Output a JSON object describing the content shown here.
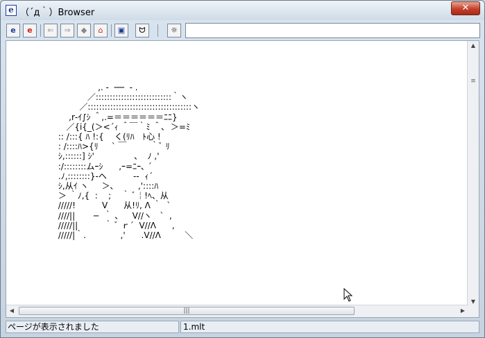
{
  "window": {
    "title": "（´д｀）Browser",
    "icon": "ie-e-icon",
    "close_label": "✕"
  },
  "toolbar": {
    "buttons": [
      {
        "icon": "browser-e-icon",
        "glyph": "e"
      },
      {
        "icon": "browser-e-red-icon",
        "glyph": "e"
      },
      {
        "icon": "back-icon",
        "glyph": "⇐"
      },
      {
        "icon": "forward-icon",
        "glyph": "⇒"
      },
      {
        "icon": "stop-icon",
        "glyph": "◆"
      },
      {
        "icon": "home-icon",
        "glyph": "⌂"
      },
      {
        "icon": "window-icon",
        "glyph": "▣"
      },
      {
        "icon": "face-icon",
        "glyph": "ᗢ"
      },
      {
        "icon": "settings-icon",
        "glyph": "☼"
      }
    ],
    "address_value": ""
  },
  "content": {
    "ascii_art": "                     ,. -  ──  - .\n                 ／:::::::::::::::::::::::::::｀ヽ\n              ／:::::::::::::::::::::::::::::::::::::ヽ\n          ,r‐ｲ∫ｼ ＾,.=＝＝＝＝＝＝ﾆﾆ}\n         ／{i{_(＞<´ｨ ＾￣｀ﾐ ＾､  ＞=ﾐ\n      :: /:::{ ﾊ !:{    く(ﾘﾊ   ﾄ心 !\n      : /::::ﾊ>{ﾘ     ` ￣         ｀ﾞ ﾘ\n      ｼ,::::::] ｼ'               、  ﾉ ,'\n      :/::::::::ムｰｼ      ,ｰ=ﾆｰ､ ´\n      .ﾉ,::::::::}‐ヘ          ‐‐  ｨ´\n      ｼ,从ｲ ヽ     ＞､         ,'::::ﾊ\n      ＞ ｀ﾉ,{  :    ;    ｀ ﾞ￤!ﾍ、从\n      /////!          V      从!ﾘ, Λ ｀  ` \n      ////||       ─  ｀ ､     V//ヽ   `  ,\n      /////||          ｀ ﾞ ｒ´  V//Λ      ,    \n      /////|｀.             ,'      .V//Λ         ＼"
  },
  "status": {
    "message": "ページが表示されました",
    "file": "1.mlt"
  }
}
